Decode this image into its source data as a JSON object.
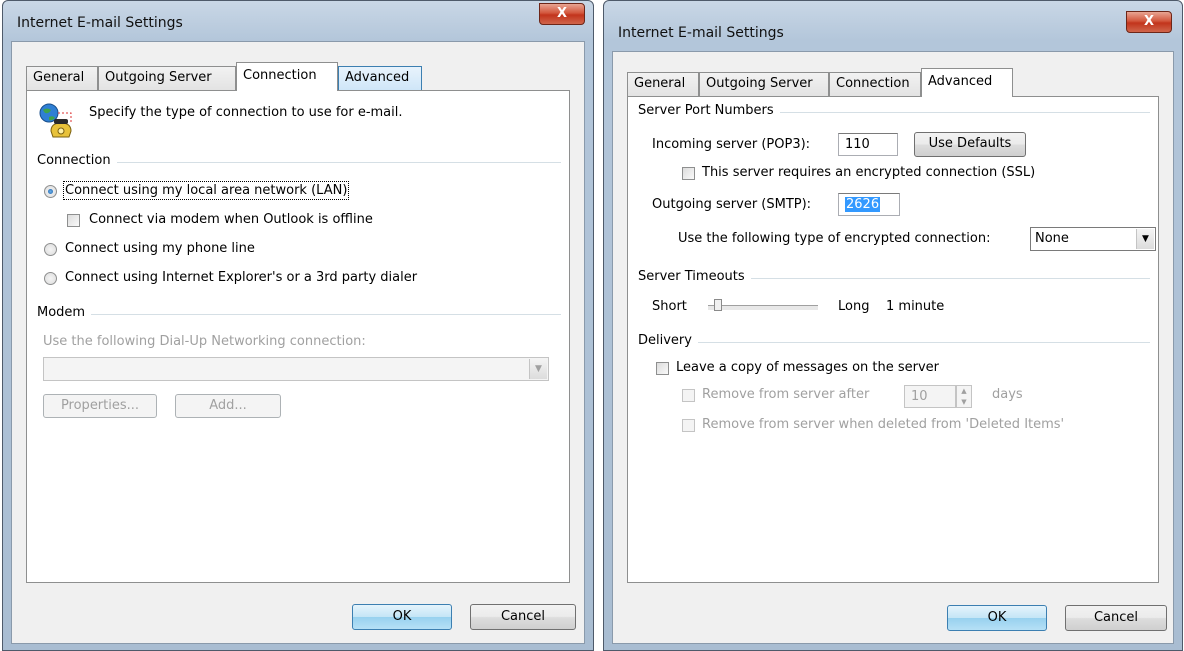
{
  "left_dialog": {
    "title": "Internet E-mail Settings",
    "close_glyph": "X",
    "tabs": [
      "General",
      "Outgoing Server",
      "Connection",
      "Advanced"
    ],
    "active_tab": "Connection",
    "intro": "Specify the type of connection to use for e-mail.",
    "connection_group": "Connection",
    "radio_lan": "Connect using my local area network (LAN)",
    "check_modem_offline": "Connect via modem when Outlook is offline",
    "radio_phone": "Connect using my phone line",
    "radio_dialer": "Connect using Internet Explorer's or a 3rd party dialer",
    "modem_group": "Modem",
    "dialup_label": "Use the following Dial-Up Networking connection:",
    "dialup_value": "",
    "properties_button": "Properties...",
    "add_button": "Add...",
    "ok_button": "OK",
    "cancel_button": "Cancel",
    "icons": [
      "globe-phone-icon",
      "chevron-down-icon"
    ]
  },
  "right_dialog": {
    "title": "Internet E-mail Settings",
    "close_glyph": "X",
    "tabs": [
      "General",
      "Outgoing Server",
      "Connection",
      "Advanced"
    ],
    "active_tab": "Advanced",
    "ports_group": "Server Port Numbers",
    "incoming_label": "Incoming server (POP3):",
    "incoming_value": "110",
    "use_defaults_button": "Use Defaults",
    "ssl_label": "This server requires an encrypted connection (SSL)",
    "outgoing_label": "Outgoing server (SMTP):",
    "outgoing_value": "2626",
    "encryption_label": "Use the following type of encrypted connection:",
    "encryption_value": "None",
    "timeouts_group": "Server Timeouts",
    "short_label": "Short",
    "long_label": "Long",
    "timeout_value": "1 minute",
    "delivery_group": "Delivery",
    "leave_copy_label": "Leave a copy of messages on the server",
    "remove_after_label": "Remove from server after",
    "remove_after_value": "10",
    "days_label": "days",
    "remove_deleted_label": "Remove from server when deleted from 'Deleted Items'",
    "ok_button": "OK",
    "cancel_button": "Cancel"
  },
  "colors": {
    "selection": "#3399ff",
    "frame": "#b3c6da",
    "close": "#c2341c"
  }
}
